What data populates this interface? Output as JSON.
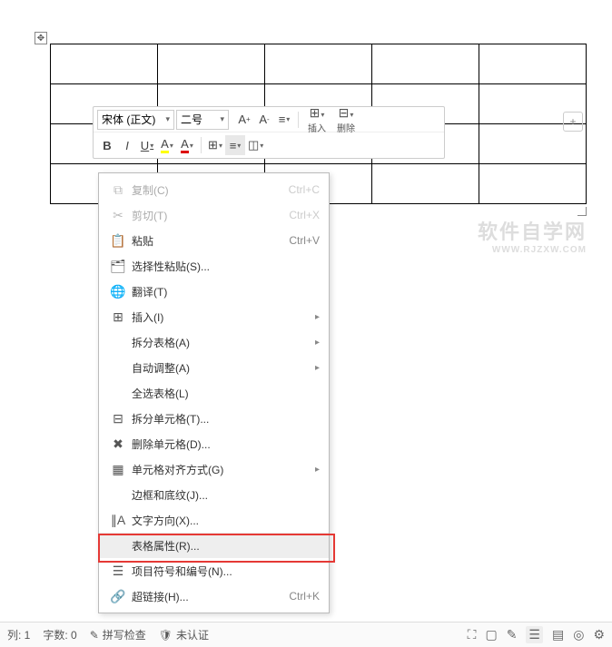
{
  "toolbar": {
    "font_name": "宋体 (正文)",
    "font_size": "二号",
    "increase_font": "A",
    "decrease_font": "A",
    "line_spacing": "",
    "bold": "B",
    "italic": "I",
    "underline": "U",
    "insert_label": "插入",
    "delete_label": "删除"
  },
  "context_menu": {
    "copy": "复制(C)",
    "copy_shortcut": "Ctrl+C",
    "cut": "剪切(T)",
    "cut_shortcut": "Ctrl+X",
    "paste": "粘贴",
    "paste_shortcut": "Ctrl+V",
    "paste_special": "选择性粘贴(S)...",
    "translate": "翻译(T)",
    "insert": "插入(I)",
    "split_table": "拆分表格(A)",
    "auto_fit": "自动调整(A)",
    "select_all_table": "全选表格(L)",
    "split_cell": "拆分单元格(T)...",
    "delete_cell": "删除单元格(D)...",
    "cell_alignment": "单元格对齐方式(G)",
    "borders_shading": "边框和底纹(J)...",
    "text_direction": "文字方向(X)...",
    "table_properties": "表格属性(R)...",
    "bullets_numbering": "项目符号和编号(N)...",
    "hyperlink": "超链接(H)...",
    "hyperlink_shortcut": "Ctrl+K"
  },
  "status": {
    "column": "列: 1",
    "word_count": "字数: 0",
    "spell_check": "拼写检查",
    "not_verified": "未认证"
  },
  "watermark": {
    "main": "软件自学网",
    "sub": "WWW.RJZXW.COM"
  }
}
